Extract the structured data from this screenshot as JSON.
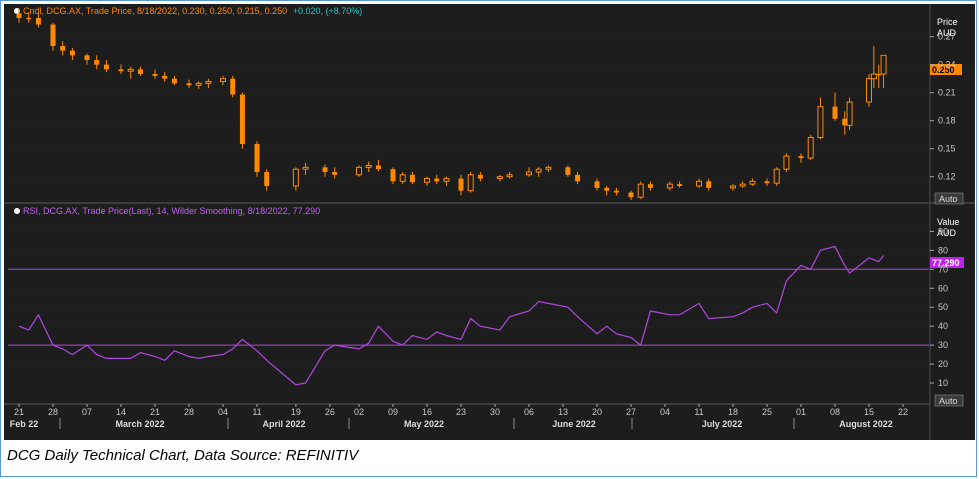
{
  "colors": {
    "background": "#1d1d1d",
    "candle_up": "#ff8a00",
    "candle_down": "#ff8a00",
    "price_header": "#ff8a00",
    "change_header": "#20c8c8",
    "rsi_line": "#b048e0",
    "rsi_header": "#c060f0",
    "rsi_ref_lines": "#b048e0",
    "price_badge": "#ff8a00",
    "rsi_badge": "#c020f0",
    "axis_text": "#c8c8c8",
    "grid": "#3a3a3a"
  },
  "price_panel": {
    "header_prefix": "Cndl, DCG.AX, Trade Price, 8/18/2022, 0.230, 0.250, 0.215, 0.250",
    "header_change": "+0.020, (+8.70%)",
    "axis_title_1": "Price",
    "axis_title_2": "AUD",
    "last_value_badge": "0.250",
    "auto_button": "Auto",
    "y_ticks": [
      "0.27",
      "0.24",
      "0.21",
      "0.18",
      "0.15",
      "0.12"
    ]
  },
  "rsi_panel": {
    "header": "RSI, DCG.AX, Trade Price(Last),  14, Wilder Smoothing, 8/18/2022, 77.290",
    "axis_title_1": "Value",
    "axis_title_2": "AUD",
    "last_value_badge": "77.290",
    "auto_button": "Auto",
    "y_ticks": [
      "90",
      "80",
      "70",
      "60",
      "50",
      "40",
      "30",
      "20",
      "10"
    ]
  },
  "x_axis": {
    "day_ticks": [
      "21",
      "28",
      "07",
      "14",
      "21",
      "28",
      "04",
      "11",
      "19",
      "26",
      "02",
      "09",
      "16",
      "23",
      "30",
      "06",
      "13",
      "20",
      "27",
      "04",
      "11",
      "18",
      "25",
      "01",
      "08",
      "15",
      "22"
    ],
    "months": [
      "Feb 22",
      "March 2022",
      "April 2022",
      "May 2022",
      "June 2022",
      "July 2022",
      "August 2022"
    ]
  },
  "caption": "DCG Daily Technical Chart, Data Source: REFINITIV",
  "chart_data": [
    {
      "type": "candlestick",
      "title": "Cndl, DCG.AX, Trade Price, 8/18/2022, 0.230, 0.250, 0.215, 0.250 +0.020, (+8.70%)",
      "ylabel": "Price AUD",
      "ylim": [
        0.095,
        0.29
      ],
      "x_range": [
        "2022-02-21",
        "2022-08-22"
      ],
      "candles": [
        {
          "date": "2022-02-21",
          "open": 0.295,
          "high": 0.3,
          "low": 0.285,
          "close": 0.29
        },
        {
          "date": "2022-02-23",
          "open": 0.29,
          "high": 0.295,
          "low": 0.285,
          "close": 0.29
        },
        {
          "date": "2022-02-25",
          "open": 0.29,
          "high": 0.295,
          "low": 0.28,
          "close": 0.283
        },
        {
          "date": "2022-02-28",
          "open": 0.283,
          "high": 0.285,
          "low": 0.255,
          "close": 0.26
        },
        {
          "date": "2022-03-02",
          "open": 0.26,
          "high": 0.265,
          "low": 0.25,
          "close": 0.255
        },
        {
          "date": "2022-03-04",
          "open": 0.255,
          "high": 0.258,
          "low": 0.245,
          "close": 0.25
        },
        {
          "date": "2022-03-07",
          "open": 0.25,
          "high": 0.252,
          "low": 0.24,
          "close": 0.245
        },
        {
          "date": "2022-03-09",
          "open": 0.245,
          "high": 0.25,
          "low": 0.235,
          "close": 0.24
        },
        {
          "date": "2022-03-11",
          "open": 0.24,
          "high": 0.245,
          "low": 0.232,
          "close": 0.235
        },
        {
          "date": "2022-03-14",
          "open": 0.235,
          "high": 0.24,
          "low": 0.23,
          "close": 0.233
        },
        {
          "date": "2022-03-16",
          "open": 0.233,
          "high": 0.238,
          "low": 0.225,
          "close": 0.235
        },
        {
          "date": "2022-03-18",
          "open": 0.235,
          "high": 0.238,
          "low": 0.228,
          "close": 0.23
        },
        {
          "date": "2022-03-21",
          "open": 0.23,
          "high": 0.235,
          "low": 0.225,
          "close": 0.228
        },
        {
          "date": "2022-03-23",
          "open": 0.228,
          "high": 0.232,
          "low": 0.222,
          "close": 0.225
        },
        {
          "date": "2022-03-25",
          "open": 0.225,
          "high": 0.228,
          "low": 0.218,
          "close": 0.22
        },
        {
          "date": "2022-03-28",
          "open": 0.22,
          "high": 0.224,
          "low": 0.215,
          "close": 0.218
        },
        {
          "date": "2022-03-30",
          "open": 0.218,
          "high": 0.222,
          "low": 0.214,
          "close": 0.22
        },
        {
          "date": "2022-04-01",
          "open": 0.22,
          "high": 0.225,
          "low": 0.215,
          "close": 0.222
        },
        {
          "date": "2022-04-04",
          "open": 0.222,
          "high": 0.228,
          "low": 0.218,
          "close": 0.225
        },
        {
          "date": "2022-04-06",
          "open": 0.225,
          "high": 0.228,
          "low": 0.205,
          "close": 0.208
        },
        {
          "date": "2022-04-08",
          "open": 0.208,
          "high": 0.21,
          "low": 0.15,
          "close": 0.155
        },
        {
          "date": "2022-04-11",
          "open": 0.155,
          "high": 0.158,
          "low": 0.12,
          "close": 0.125
        },
        {
          "date": "2022-04-13",
          "open": 0.125,
          "high": 0.128,
          "low": 0.105,
          "close": 0.11
        },
        {
          "date": "2022-04-19",
          "open": 0.11,
          "high": 0.13,
          "low": 0.105,
          "close": 0.128
        },
        {
          "date": "2022-04-21",
          "open": 0.128,
          "high": 0.135,
          "low": 0.122,
          "close": 0.13
        },
        {
          "date": "2022-04-25",
          "open": 0.13,
          "high": 0.133,
          "low": 0.12,
          "close": 0.125
        },
        {
          "date": "2022-04-27",
          "open": 0.125,
          "high": 0.13,
          "low": 0.118,
          "close": 0.122
        },
        {
          "date": "2022-05-02",
          "open": 0.122,
          "high": 0.132,
          "low": 0.12,
          "close": 0.13
        },
        {
          "date": "2022-05-04",
          "open": 0.13,
          "high": 0.136,
          "low": 0.125,
          "close": 0.132
        },
        {
          "date": "2022-05-06",
          "open": 0.132,
          "high": 0.138,
          "low": 0.126,
          "close": 0.128
        },
        {
          "date": "2022-05-09",
          "open": 0.128,
          "high": 0.13,
          "low": 0.112,
          "close": 0.115
        },
        {
          "date": "2022-05-11",
          "open": 0.115,
          "high": 0.125,
          "low": 0.112,
          "close": 0.122
        },
        {
          "date": "2022-05-13",
          "open": 0.122,
          "high": 0.125,
          "low": 0.112,
          "close": 0.114
        },
        {
          "date": "2022-05-16",
          "open": 0.114,
          "high": 0.12,
          "low": 0.11,
          "close": 0.118
        },
        {
          "date": "2022-05-18",
          "open": 0.118,
          "high": 0.122,
          "low": 0.112,
          "close": 0.115
        },
        {
          "date": "2022-05-20",
          "open": 0.115,
          "high": 0.12,
          "low": 0.11,
          "close": 0.118
        },
        {
          "date": "2022-05-23",
          "open": 0.118,
          "high": 0.122,
          "low": 0.1,
          "close": 0.105
        },
        {
          "date": "2022-05-25",
          "open": 0.105,
          "high": 0.125,
          "low": 0.103,
          "close": 0.122
        },
        {
          "date": "2022-05-27",
          "open": 0.122,
          "high": 0.125,
          "low": 0.115,
          "close": 0.118
        },
        {
          "date": "2022-05-31",
          "open": 0.118,
          "high": 0.122,
          "low": 0.115,
          "close": 0.12
        },
        {
          "date": "2022-06-02",
          "open": 0.12,
          "high": 0.125,
          "low": 0.118,
          "close": 0.122
        },
        {
          "date": "2022-06-06",
          "open": 0.122,
          "high": 0.13,
          "low": 0.12,
          "close": 0.125
        },
        {
          "date": "2022-06-08",
          "open": 0.125,
          "high": 0.13,
          "low": 0.12,
          "close": 0.128
        },
        {
          "date": "2022-06-10",
          "open": 0.128,
          "high": 0.132,
          "low": 0.125,
          "close": 0.13
        },
        {
          "date": "2022-06-14",
          "open": 0.13,
          "high": 0.132,
          "low": 0.12,
          "close": 0.122
        },
        {
          "date": "2022-06-16",
          "open": 0.122,
          "high": 0.125,
          "low": 0.112,
          "close": 0.115
        },
        {
          "date": "2022-06-20",
          "open": 0.115,
          "high": 0.118,
          "low": 0.105,
          "close": 0.108
        },
        {
          "date": "2022-06-22",
          "open": 0.108,
          "high": 0.11,
          "low": 0.1,
          "close": 0.105
        },
        {
          "date": "2022-06-24",
          "open": 0.105,
          "high": 0.108,
          "low": 0.1,
          "close": 0.103
        },
        {
          "date": "2022-06-27",
          "open": 0.103,
          "high": 0.105,
          "low": 0.095,
          "close": 0.098
        },
        {
          "date": "2022-06-29",
          "open": 0.098,
          "high": 0.115,
          "low": 0.096,
          "close": 0.112
        },
        {
          "date": "2022-07-01",
          "open": 0.112,
          "high": 0.115,
          "low": 0.105,
          "close": 0.108
        },
        {
          "date": "2022-07-05",
          "open": 0.108,
          "high": 0.115,
          "low": 0.105,
          "close": 0.112
        },
        {
          "date": "2022-07-07",
          "open": 0.112,
          "high": 0.115,
          "low": 0.108,
          "close": 0.11
        },
        {
          "date": "2022-07-11",
          "open": 0.11,
          "high": 0.118,
          "low": 0.108,
          "close": 0.115
        },
        {
          "date": "2022-07-13",
          "open": 0.115,
          "high": 0.118,
          "low": 0.105,
          "close": 0.108
        },
        {
          "date": "2022-07-18",
          "open": 0.108,
          "high": 0.112,
          "low": 0.105,
          "close": 0.11
        },
        {
          "date": "2022-07-20",
          "open": 0.11,
          "high": 0.115,
          "low": 0.108,
          "close": 0.112
        },
        {
          "date": "2022-07-22",
          "open": 0.112,
          "high": 0.118,
          "low": 0.11,
          "close": 0.115
        },
        {
          "date": "2022-07-25",
          "open": 0.115,
          "high": 0.118,
          "low": 0.11,
          "close": 0.113
        },
        {
          "date": "2022-07-27",
          "open": 0.113,
          "high": 0.13,
          "low": 0.11,
          "close": 0.128
        },
        {
          "date": "2022-07-29",
          "open": 0.128,
          "high": 0.145,
          "low": 0.125,
          "close": 0.142
        },
        {
          "date": "2022-08-01",
          "open": 0.142,
          "high": 0.145,
          "low": 0.135,
          "close": 0.14
        },
        {
          "date": "2022-08-03",
          "open": 0.14,
          "high": 0.165,
          "low": 0.138,
          "close": 0.162
        },
        {
          "date": "2022-08-05",
          "open": 0.162,
          "high": 0.205,
          "low": 0.16,
          "close": 0.195
        },
        {
          "date": "2022-08-08",
          "open": 0.195,
          "high": 0.21,
          "low": 0.18,
          "close": 0.182
        },
        {
          "date": "2022-08-10",
          "open": 0.182,
          "high": 0.19,
          "low": 0.165,
          "close": 0.175
        },
        {
          "date": "2022-08-11",
          "open": 0.175,
          "high": 0.205,
          "low": 0.17,
          "close": 0.2
        },
        {
          "date": "2022-08-15",
          "open": 0.2,
          "high": 0.23,
          "low": 0.195,
          "close": 0.225
        },
        {
          "date": "2022-08-16",
          "open": 0.225,
          "high": 0.26,
          "low": 0.215,
          "close": 0.23
        },
        {
          "date": "2022-08-17",
          "open": 0.23,
          "high": 0.24,
          "low": 0.215,
          "close": 0.23
        },
        {
          "date": "2022-08-18",
          "open": 0.23,
          "high": 0.25,
          "low": 0.215,
          "close": 0.25
        }
      ]
    },
    {
      "type": "line",
      "title": "RSI, DCG.AX, Trade Price(Last),  14, Wilder Smoothing, 8/18/2022, 77.290",
      "ylabel": "Value AUD",
      "ylim": [
        0,
        96
      ],
      "reference_lines": [
        30,
        70
      ],
      "series": [
        {
          "name": "RSI",
          "x": [
            "2022-02-21",
            "2022-02-23",
            "2022-02-25",
            "2022-02-28",
            "2022-03-02",
            "2022-03-04",
            "2022-03-07",
            "2022-03-09",
            "2022-03-11",
            "2022-03-14",
            "2022-03-16",
            "2022-03-18",
            "2022-03-21",
            "2022-03-23",
            "2022-03-25",
            "2022-03-28",
            "2022-03-30",
            "2022-04-01",
            "2022-04-04",
            "2022-04-06",
            "2022-04-08",
            "2022-04-11",
            "2022-04-13",
            "2022-04-19",
            "2022-04-21",
            "2022-04-25",
            "2022-04-27",
            "2022-05-02",
            "2022-05-04",
            "2022-05-06",
            "2022-05-09",
            "2022-05-11",
            "2022-05-13",
            "2022-05-16",
            "2022-05-18",
            "2022-05-20",
            "2022-05-23",
            "2022-05-25",
            "2022-05-27",
            "2022-05-31",
            "2022-06-02",
            "2022-06-06",
            "2022-06-08",
            "2022-06-10",
            "2022-06-14",
            "2022-06-16",
            "2022-06-20",
            "2022-06-22",
            "2022-06-24",
            "2022-06-27",
            "2022-06-29",
            "2022-07-01",
            "2022-07-05",
            "2022-07-07",
            "2022-07-11",
            "2022-07-13",
            "2022-07-18",
            "2022-07-20",
            "2022-07-22",
            "2022-07-25",
            "2022-07-27",
            "2022-07-29",
            "2022-08-01",
            "2022-08-03",
            "2022-08-05",
            "2022-08-08",
            "2022-08-10",
            "2022-08-11",
            "2022-08-15",
            "2022-08-16",
            "2022-08-17",
            "2022-08-18"
          ],
          "values": [
            40,
            38,
            46,
            30,
            28,
            25,
            30,
            25,
            23,
            23,
            23,
            26,
            24,
            22,
            27,
            24,
            23,
            24,
            25,
            28,
            33,
            27,
            22,
            9,
            10,
            27,
            30,
            28,
            31,
            40,
            32,
            30,
            35,
            33,
            37,
            35,
            33,
            44,
            40,
            38,
            45,
            48,
            53,
            52,
            50,
            45,
            36,
            40,
            36,
            34,
            30,
            48,
            46,
            46,
            52,
            44,
            45,
            47,
            50,
            52,
            47,
            64,
            72,
            70,
            80,
            82,
            72,
            68,
            76,
            75,
            74,
            77.29
          ]
        }
      ]
    }
  ]
}
